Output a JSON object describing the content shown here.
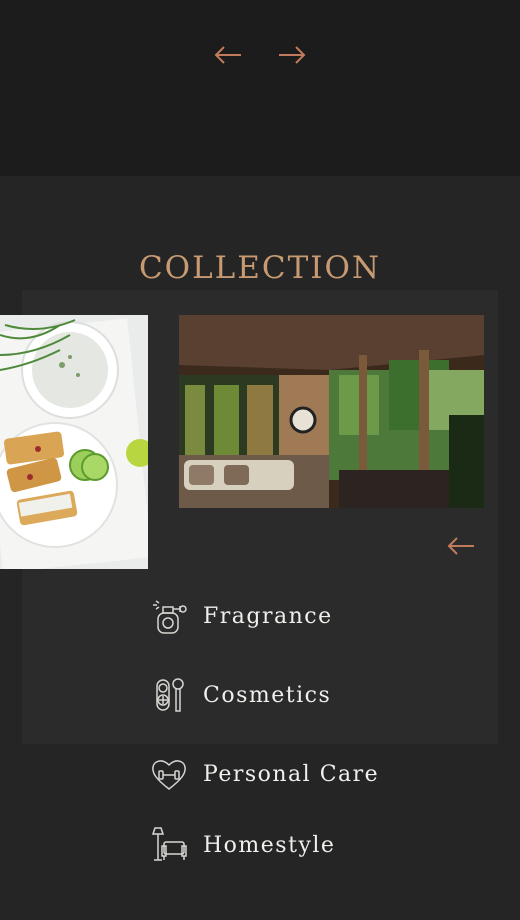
{
  "nav": {
    "prev_label": "previous",
    "next_label": "next",
    "accent": "#c07b5c"
  },
  "section": {
    "title": "COLLECTION",
    "title_color": "#c79a72"
  },
  "carousel": {
    "slides": [
      {
        "image": "food-plate-photo"
      },
      {
        "image": "living-room-patio-photo"
      }
    ],
    "prev_label": "previous slide"
  },
  "categories": [
    {
      "label": "Fragrance",
      "icon": "perfume-bottle-icon"
    },
    {
      "label": "Cosmetics",
      "icon": "makeup-brush-icon"
    },
    {
      "label": "Personal Care",
      "icon": "heart-dumbbell-icon"
    },
    {
      "label": "Homestyle",
      "icon": "lamp-armchair-icon"
    }
  ]
}
